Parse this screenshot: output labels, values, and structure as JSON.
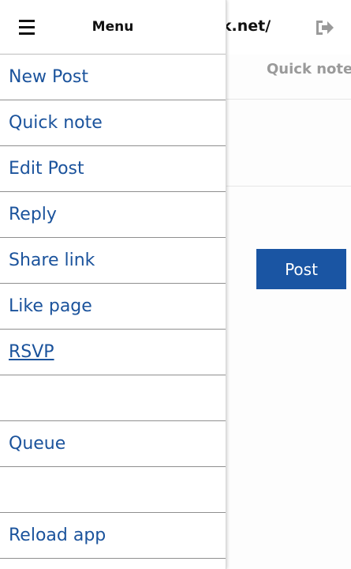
{
  "background": {
    "domain_fragment": "ek.net/",
    "tab_label": "Quick note",
    "post_button_label": "Post",
    "accent_color": "#1a55a3"
  },
  "drawer": {
    "title": "Menu",
    "items": [
      {
        "label": "New Post"
      },
      {
        "label": "Quick note"
      },
      {
        "label": "Edit Post"
      },
      {
        "label": "Reply"
      },
      {
        "label": "Share link"
      },
      {
        "label": "Like page"
      },
      {
        "label": "RSVP"
      },
      {
        "label": ""
      },
      {
        "label": "Queue"
      },
      {
        "label": ""
      },
      {
        "label": "Reload app"
      }
    ],
    "link_color": "#1b539c"
  },
  "icons": {
    "menu": "hamburger-icon",
    "logout": "sign-out-icon"
  }
}
